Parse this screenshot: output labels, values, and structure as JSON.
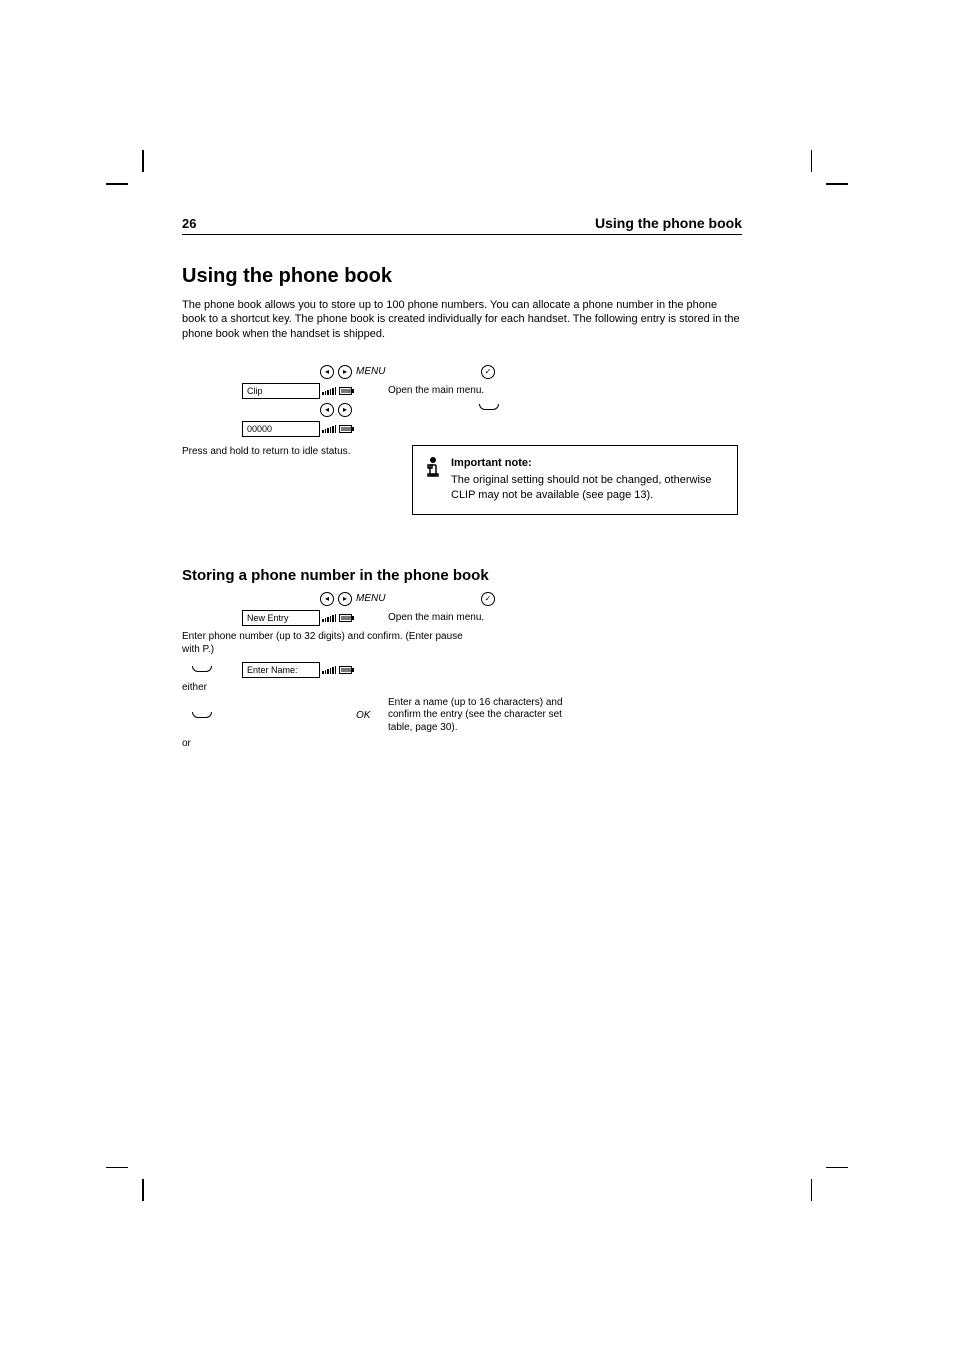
{
  "header": {
    "page_number": "26",
    "section": "Using the phone book"
  },
  "s1": {
    "title": "Using the phone book",
    "intro": "The phone book allows you to store up to 100 phone numbers. You can allocate a phone number in the phone book to a shortcut key. The phone book is created individually for each handset. The following entry is stored in the phone book when the handset is shipped."
  },
  "proc1": {
    "label1": "MENU",
    "desc1": "Open the  main menu.",
    "display1": "Clip",
    "display2": "00000",
    "desc2": "Press and hold to return to idle status."
  },
  "info": {
    "title": "Important note:",
    "body": "The original setting should not be changed, otherwise CLIP may not be available (see page 13)."
  },
  "s2": {
    "title": "Storing a phone number in the phone book",
    "label1": "MENU",
    "desc1": "Open the main menu.",
    "display1": "New Entry",
    "desc2": "Enter phone number (up to 32 digits) and confirm. (Enter pause with P.)",
    "display2": "Enter Name:",
    "either": "either",
    "desc3": "Enter a name (up to 16 characters) and confirm the entry (see the character set table, page 30).",
    "or": "or",
    "label3": "OK"
  },
  "icons": {
    "left": "◂",
    "right": "▸",
    "check": "✓"
  }
}
